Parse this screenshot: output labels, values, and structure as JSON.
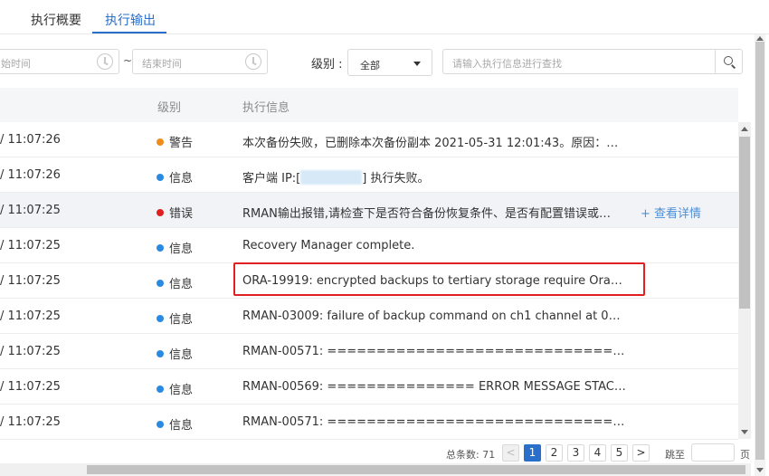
{
  "tabs": [
    {
      "label": "执行概要"
    },
    {
      "label": "执行输出"
    }
  ],
  "filters": {
    "start_placeholder": "始时间",
    "range_sep": "~",
    "end_placeholder": "结束时间",
    "level_label": "级别 :",
    "level_value": "全部",
    "search_placeholder": "请输入执行信息进行查找"
  },
  "table": {
    "headers": {
      "level": "级别",
      "info": "执行信息"
    },
    "detail_link": "+ 查看详情",
    "rows": [
      {
        "time": "/ 11:07:26",
        "level": "警告",
        "color": "#f08c1a",
        "msg": "本次备份失败，已删除本次备份副本 2021-05-31 12:01:43。原因：检查…"
      },
      {
        "time": "/ 11:07:26",
        "level": "信息",
        "color": "#2a8ae2",
        "msg_pre": "客户端 IP:[",
        "msg_post": "] 执行失败。"
      },
      {
        "time": "/ 11:07:25",
        "level": "错误",
        "color": "#e02020",
        "msg": "RMAN输出报错,请检查下是否符合备份恢复条件、是否有配置错误或…"
      },
      {
        "time": "/ 11:07:25",
        "level": "信息",
        "color": "#2a8ae2",
        "msg": "Recovery Manager complete."
      },
      {
        "time": "/ 11:07:25",
        "level": "信息",
        "color": "#2a8ae2",
        "msg": "ORA-19919: encrypted backups to tertiary storage require Oracle Se…"
      },
      {
        "time": "/ 11:07:25",
        "level": "信息",
        "color": "#2a8ae2",
        "msg": "RMAN-03009: failure of backup command on ch1 channel at 05/31/…"
      },
      {
        "time": "/ 11:07:25",
        "level": "信息",
        "color": "#2a8ae2",
        "msg": "RMAN-00571: ===========================================…"
      },
      {
        "time": "/ 11:07:25",
        "level": "信息",
        "color": "#2a8ae2",
        "msg": "RMAN-00569: =============== ERROR MESSAGE STACK FOLLOWS …"
      },
      {
        "time": "/ 11:07:25",
        "level": "信息",
        "color": "#2a8ae2",
        "msg": "RMAN-00571: ===========================================…"
      }
    ]
  },
  "pager": {
    "total": "总条数: 71",
    "prev": "<",
    "pages": [
      "1",
      "2",
      "3",
      "4",
      "5"
    ],
    "next": ">",
    "jump_label": "跳至",
    "page_suffix": "页"
  }
}
